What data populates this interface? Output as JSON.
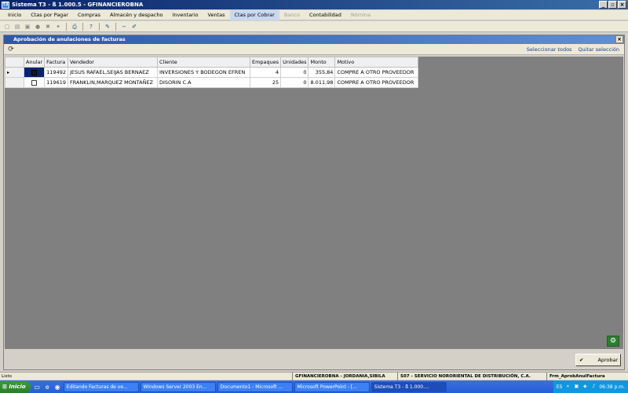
{
  "window": {
    "title": "Sistema T3 - ß 1.000.5 - GFINANCIEROBNA",
    "app_icon": "T3"
  },
  "menu": [
    {
      "label": "Inicio",
      "state": "normal"
    },
    {
      "label": "Ctas por Pagar",
      "state": "normal"
    },
    {
      "label": "Compras",
      "state": "normal"
    },
    {
      "label": "Almacén y despacho",
      "state": "normal"
    },
    {
      "label": "Inventario",
      "state": "normal"
    },
    {
      "label": "Ventas",
      "state": "normal"
    },
    {
      "label": "Ctas por Cobrar",
      "state": "active"
    },
    {
      "label": "Banco",
      "state": "disabled"
    },
    {
      "label": "Contabilidad",
      "state": "normal"
    },
    {
      "label": "Nómina",
      "state": "disabled"
    }
  ],
  "child": {
    "title": "Aprobación de anulaciones de facturas",
    "select_all": "Seleccionar todos",
    "clear_selection": "Quitar selección",
    "approve_label": "Aprobar",
    "columns": [
      "Anular",
      "Factura",
      "Vendedor",
      "Cliente",
      "Empaques",
      "Unidades",
      "Monto",
      "Motivo"
    ],
    "rows": [
      {
        "anular": true,
        "factura": "119492",
        "vendedor": "JESUS RAFAEL,SEIJAS BERNAEZ",
        "cliente": "INVERSIONES Y BODEGON EFREN",
        "empaques": "4",
        "unidades": "0",
        "monto": "355,84",
        "motivo": "COMPRE A OTRO PROVEEDOR"
      },
      {
        "anular": false,
        "factura": "119619",
        "vendedor": "FRANKLIN,MARQUEZ MONTAÑEZ",
        "cliente": "DISORIN C.A",
        "empaques": "25",
        "unidades": "0",
        "monto": "8.011,98",
        "motivo": "COMPRE A OTRO PROVEEDOR"
      }
    ]
  },
  "status": {
    "ready": "Listo",
    "user": "GFINANCIEROBNA - JORDANIA,SIBILA",
    "company": "S07 - SERVICIO NORORIENTAL DE DISTRIBUCIÓN, C.A.",
    "form": "Frm_AprobAnulFactura"
  },
  "taskbar": {
    "start": "Inicio",
    "tasks": [
      {
        "label": "Editando Facturas de ve...",
        "active": false
      },
      {
        "label": "Windows Server 2003 En...",
        "active": false
      },
      {
        "label": "Documento1 - Microsoft ...",
        "active": false
      },
      {
        "label": "Microsoft PowerPoint - [...",
        "active": false
      },
      {
        "label": "Sistema T3 - ß 1.000....",
        "active": true
      }
    ],
    "lang": "ES",
    "clock": "06:38 p.m."
  }
}
